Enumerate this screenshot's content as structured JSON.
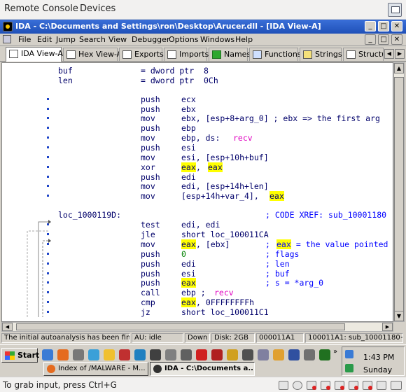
{
  "outer": {
    "menu": [
      "Remote Console",
      "Devices"
    ],
    "hint": "To grab input, press Ctrl+G"
  },
  "window": {
    "title": "IDA - C:\\Documents and Settings\\ron\\Desktop\\Arucer.dll - [IDA View-A]",
    "controls": {
      "minimize": "_",
      "maximize": "□",
      "close": "✕"
    }
  },
  "menubar": [
    "File",
    "Edit",
    "Jump",
    "Search",
    "View",
    "Debugger",
    "Options",
    "Windows",
    "Help"
  ],
  "tabs": [
    "IDA View-A",
    "Hex View-A",
    "Exports",
    "Imports",
    "Names",
    "Functions",
    "Strings",
    "Structu"
  ],
  "code": {
    "header": [
      {
        "c1": "buf",
        "c2": "= dword ptr  8"
      },
      {
        "c1": "len",
        "c2": "= dword ptr  0Ch"
      }
    ],
    "block1": [
      {
        "op": "push",
        "arg": "ecx"
      },
      {
        "op": "push",
        "arg": "ebx"
      },
      {
        "op": "mov",
        "arg": "ebx, [esp+8+arg_0] ; ebx => the first arg"
      },
      {
        "op": "push",
        "arg": "ebp"
      },
      {
        "op": "mov",
        "arg_pre": "ebp, ds:",
        "arg_pink": "recv"
      },
      {
        "op": "push",
        "arg": "esi"
      },
      {
        "op": "mov",
        "arg": "esi, [esp+10h+buf]"
      },
      {
        "op": "xor",
        "hl1": "eax",
        "mid": ", ",
        "hl2": "eax"
      },
      {
        "op": "push",
        "arg": "edi"
      },
      {
        "op": "mov",
        "arg": "edi, [esp+14h+len]"
      },
      {
        "op": "mov",
        "arg_pre": "[esp+14h+var_4], ",
        "hl": "eax"
      }
    ],
    "label": {
      "name": "loc_1000119D:",
      "xref": "; CODE XREF: sub_10001180"
    },
    "block2": [
      {
        "op": "test",
        "arg": "edi, edi"
      },
      {
        "op": "jle",
        "arg": "short loc_100011CA"
      },
      {
        "op": "mov",
        "hl": "eax",
        "rest": ", [ebx]",
        "comment_hl": "eax",
        "comment": " = the value pointed"
      },
      {
        "op": "push",
        "green": "0",
        "comment": "; flags"
      },
      {
        "op": "push",
        "arg": "edi",
        "comment": "; len"
      },
      {
        "op": "push",
        "arg": "esi",
        "comment": "; buf"
      },
      {
        "op": "push",
        "hl": "eax",
        "comment": "; s = *arg_0"
      },
      {
        "op": "call",
        "arg_pre": "ebp ; ",
        "arg_pink": "recv"
      },
      {
        "op": "cmp",
        "hl": "eax",
        "rest": ", 0FFFFFFFFh"
      },
      {
        "op": "jz",
        "arg": "short loc_100011C1"
      }
    ]
  },
  "status": {
    "message": "The initial autoanalysis has been finished.",
    "au": "AU:  idle",
    "dir": "Down",
    "disk": "Disk: 2GB",
    "addr": "000011A1",
    "loc": "100011A1: sub_10001180+"
  },
  "taskbar": {
    "start": "Start",
    "tasks": [
      "Index of /MALWARE - M...",
      "IDA - C:\\Documents a..."
    ],
    "time": "1:43 PM",
    "day": "Sunday"
  },
  "colors": {
    "title_bar": "#245edb",
    "code_text": "#00006a",
    "highlight": "#ffff00",
    "name_ref": "#e000c0"
  }
}
